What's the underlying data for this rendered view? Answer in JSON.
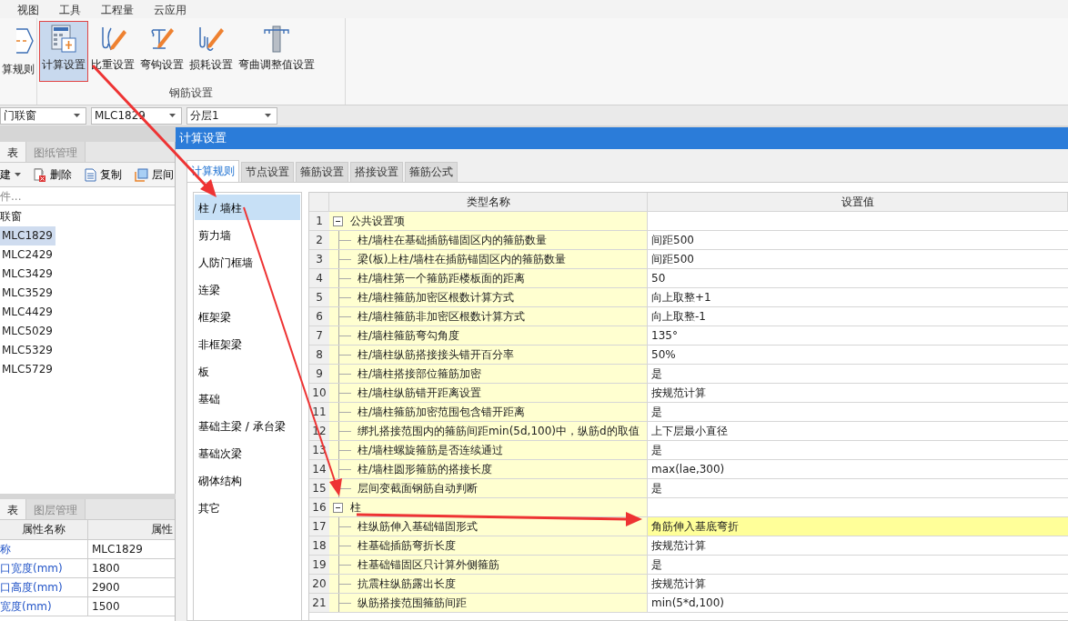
{
  "menu": [
    {
      "label": "视图"
    },
    {
      "label": "工具"
    },
    {
      "label": "工程量"
    },
    {
      "label": "云应用"
    }
  ],
  "ribbon": {
    "partial_group": {
      "label": "算规则"
    },
    "groups": [
      {
        "label": "钢筋设置",
        "buttons": [
          {
            "label": "计算设置",
            "kind": "calculator",
            "selected": true
          },
          {
            "label": "比重设置",
            "kind": "hook",
            "selected": false
          },
          {
            "label": "弯钩设置",
            "kind": "bracket",
            "selected": false
          },
          {
            "label": "损耗设置",
            "kind": "wave",
            "selected": false
          },
          {
            "label": "弯曲调整值设置",
            "kind": "column",
            "selected": false
          }
        ]
      }
    ]
  },
  "selectors": [
    {
      "value": "门联窗"
    },
    {
      "value": "MLC1829"
    },
    {
      "value": "分层1"
    }
  ],
  "component_panel": {
    "tabs": [
      {
        "label": "表",
        "selected": true
      },
      {
        "label": "图纸管理",
        "selected": false
      }
    ],
    "toolbar": [
      {
        "label": "建",
        "kind": "dropdown"
      },
      {
        "label": "删除",
        "kind": "delete"
      },
      {
        "label": "复制",
        "kind": "copy"
      },
      {
        "label": "层间",
        "kind": "layer"
      }
    ],
    "search": {
      "placeholder": "件..."
    },
    "tree": [
      {
        "label": "联窗",
        "children": [
          {
            "label": "MLC1829",
            "selected": true
          },
          {
            "label": "MLC2429",
            "selected": false
          },
          {
            "label": "MLC3429",
            "selected": false
          },
          {
            "label": "MLC3529",
            "selected": false
          },
          {
            "label": "MLC4429",
            "selected": false
          },
          {
            "label": "MLC5029",
            "selected": false
          },
          {
            "label": "MLC5329",
            "selected": false
          },
          {
            "label": "MLC5729",
            "selected": false
          }
        ]
      }
    ]
  },
  "property_panel": {
    "tabs": [
      {
        "label": "表",
        "selected": true
      },
      {
        "label": "图层管理",
        "selected": false
      }
    ],
    "columns": [
      "属性名称",
      "属性"
    ],
    "rows": [
      {
        "name": "称",
        "value": "MLC1829"
      },
      {
        "name": "口宽度(mm)",
        "value": "1800"
      },
      {
        "name": "口高度(mm)",
        "value": "2900"
      },
      {
        "name": "宽度(mm)",
        "value": "1500"
      }
    ]
  },
  "dialog": {
    "title": "计算设置",
    "tabs": [
      {
        "label": "计算规则",
        "selected": true
      },
      {
        "label": "节点设置",
        "selected": false
      },
      {
        "label": "箍筋设置",
        "selected": false
      },
      {
        "label": "搭接设置",
        "selected": false
      },
      {
        "label": "箍筋公式",
        "selected": false
      }
    ],
    "categories": [
      {
        "label": "柱 / 墙柱",
        "selected": true
      },
      {
        "label": "剪力墙",
        "selected": false
      },
      {
        "label": "人防门框墙",
        "selected": false
      },
      {
        "label": "连梁",
        "selected": false
      },
      {
        "label": "框架梁",
        "selected": false
      },
      {
        "label": "非框架梁",
        "selected": false
      },
      {
        "label": "板",
        "selected": false
      },
      {
        "label": "基础",
        "selected": false
      },
      {
        "label": "基础主梁 / 承台梁",
        "selected": false
      },
      {
        "label": "基础次梁",
        "selected": false
      },
      {
        "label": "砌体结构",
        "selected": false
      },
      {
        "label": "其它",
        "selected": false
      }
    ],
    "table": {
      "columns": [
        "类型名称",
        "设置值"
      ],
      "rows": [
        {
          "number": "1",
          "name": "公共设置项",
          "expanded": true,
          "children": [
            {
              "number": "2",
              "name": "柱/墙柱在基础插筋锚固区内的箍筋数量",
              "value": "间距500",
              "selected": false
            },
            {
              "number": "3",
              "name": "梁(板)上柱/墙柱在插筋锚固区内的箍筋数量",
              "value": "间距500",
              "selected": false
            },
            {
              "number": "4",
              "name": "柱/墙柱第一个箍筋距楼板面的距离",
              "value": "50",
              "selected": false
            },
            {
              "number": "5",
              "name": "柱/墙柱箍筋加密区根数计算方式",
              "value": "向上取整+1",
              "selected": false
            },
            {
              "number": "6",
              "name": "柱/墙柱箍筋非加密区根数计算方式",
              "value": "向上取整-1",
              "selected": false
            },
            {
              "number": "7",
              "name": "柱/墙柱箍筋弯勾角度",
              "value": "135°",
              "selected": false
            },
            {
              "number": "8",
              "name": "柱/墙柱纵筋搭接接头错开百分率",
              "value": "50%",
              "selected": false
            },
            {
              "number": "9",
              "name": "柱/墙柱搭接部位箍筋加密",
              "value": "是",
              "selected": false
            },
            {
              "number": "10",
              "name": "柱/墙柱纵筋错开距离设置",
              "value": "按规范计算",
              "selected": false
            },
            {
              "number": "11",
              "name": "柱/墙柱箍筋加密范围包含错开距离",
              "value": "是",
              "selected": false
            },
            {
              "number": "12",
              "name": "绑扎搭接范围内的箍筋间距min(5d,100)中，纵筋d的取值",
              "value": "上下层最小直径",
              "selected": false
            },
            {
              "number": "13",
              "name": "柱/墙柱螺旋箍筋是否连续通过",
              "value": "是",
              "selected": false
            },
            {
              "number": "14",
              "name": "柱/墙柱圆形箍筋的搭接长度",
              "value": "max(lae,300)",
              "selected": false
            },
            {
              "number": "15",
              "name": "层间变截面钢筋自动判断",
              "value": "是",
              "selected": false
            }
          ]
        },
        {
          "number": "16",
          "name": "柱",
          "expanded": true,
          "children": [
            {
              "number": "17",
              "name": "柱纵筋伸入基础锚固形式",
              "value": "角筋伸入基底弯折",
              "selected": true
            },
            {
              "number": "18",
              "name": "柱基础插筋弯折长度",
              "value": "按规范计算",
              "selected": false
            },
            {
              "number": "19",
              "name": "柱基础锚固区只计算外侧箍筋",
              "value": "是",
              "selected": false
            },
            {
              "number": "20",
              "name": "抗震柱纵筋露出长度",
              "value": "按规范计算",
              "selected": false
            },
            {
              "number": "21",
              "name": "纵筋搭接范围箍筋间距",
              "value": "min(5*d,100)",
              "selected": false
            }
          ]
        }
      ]
    }
  }
}
